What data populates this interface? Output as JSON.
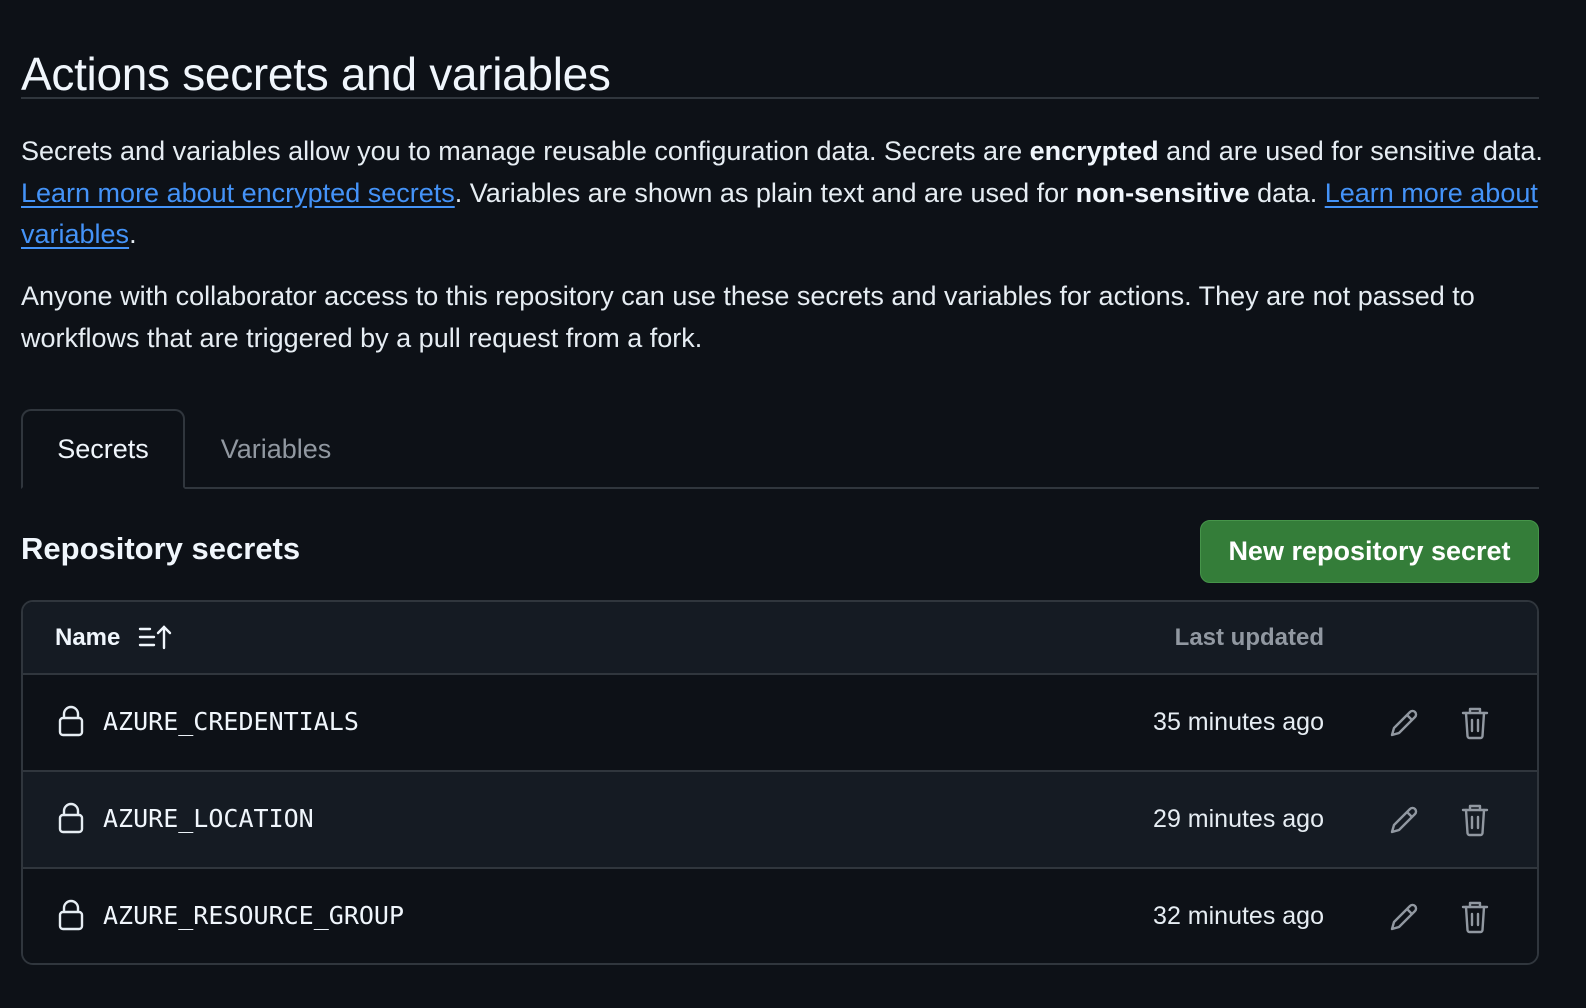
{
  "header": {
    "title": "Actions secrets and variables"
  },
  "intro": {
    "text_1": "Secrets and variables allow you to manage reusable configuration data. Secrets are ",
    "bold_1": "encrypted",
    "text_2": " and are used for sensitive data. ",
    "link_1": "Learn more about encrypted secrets",
    "text_3": ". Variables are shown as plain text and are used for ",
    "bold_2": "non-sensitive",
    "text_4": " data. ",
    "link_2": "Learn more about variables",
    "text_5": "."
  },
  "note": "Anyone with collaborator access to this repository can use these secrets and variables for actions. They are not passed to workflows that are triggered by a pull request from a fork.",
  "tabs": [
    {
      "label": "Secrets",
      "active": true
    },
    {
      "label": "Variables",
      "active": false
    }
  ],
  "section": {
    "title": "Repository secrets",
    "new_button_label": "New repository secret"
  },
  "table": {
    "columns": {
      "name": "Name",
      "last_updated": "Last updated"
    },
    "rows": [
      {
        "name": "AZURE_CREDENTIALS",
        "updated": "35 minutes ago"
      },
      {
        "name": "AZURE_LOCATION",
        "updated": "29 minutes ago"
      },
      {
        "name": "AZURE_RESOURCE_GROUP",
        "updated": "32 minutes ago"
      }
    ]
  },
  "icons": {
    "sort": "sort-ascending-icon",
    "lock": "lock-icon",
    "edit": "pencil-icon",
    "delete": "trash-icon"
  },
  "colors": {
    "background": "#0d1117",
    "link": "#4493f8",
    "primary_button": "#347d39",
    "border": "#30363d"
  }
}
